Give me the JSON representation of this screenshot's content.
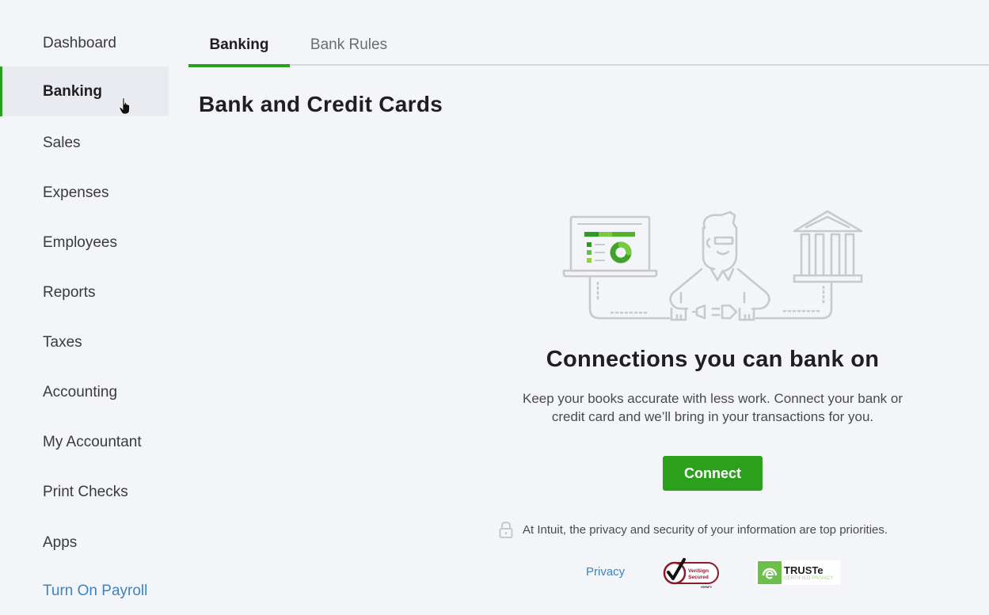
{
  "sidebar": {
    "items": [
      {
        "label": "Dashboard",
        "active": false
      },
      {
        "label": "Banking",
        "active": true
      },
      {
        "label": "Sales",
        "active": false
      },
      {
        "label": "Expenses",
        "active": false
      },
      {
        "label": "Employees",
        "active": false
      },
      {
        "label": "Reports",
        "active": false
      },
      {
        "label": "Taxes",
        "active": false
      },
      {
        "label": "Accounting",
        "active": false
      },
      {
        "label": "My Accountant",
        "active": false
      },
      {
        "label": "Print Checks",
        "active": false
      },
      {
        "label": "Apps",
        "active": false
      }
    ],
    "payroll_link": "Turn On Payroll"
  },
  "tabs": [
    {
      "label": "Banking",
      "active": true
    },
    {
      "label": "Bank Rules",
      "active": false
    }
  ],
  "page": {
    "title": "Bank and Credit Cards"
  },
  "hero": {
    "illustration": "laptop-person-bank-plug-illustration",
    "title": "Connections you can bank on",
    "body_line1": "Keep your books accurate with less work. Connect your bank or",
    "body_line2": "credit card and we’ll bring in your transactions for you.",
    "connect_label": "Connect"
  },
  "footer": {
    "privacy_notice": "At Intuit, the privacy and security of your information are top priorities.",
    "privacy_link": "Privacy",
    "verisign_line1": "VeriSign",
    "verisign_line2": "Secured",
    "verisign_verify": "VERIFY",
    "truste_name": "TRUSTe",
    "truste_sub": "CERTIFIED PRIVACY"
  },
  "colors": {
    "accent": "#2ca01c",
    "link": "#3a84c1",
    "background": "#f4f5f8",
    "active_nav_bg": "#eaebf1"
  }
}
